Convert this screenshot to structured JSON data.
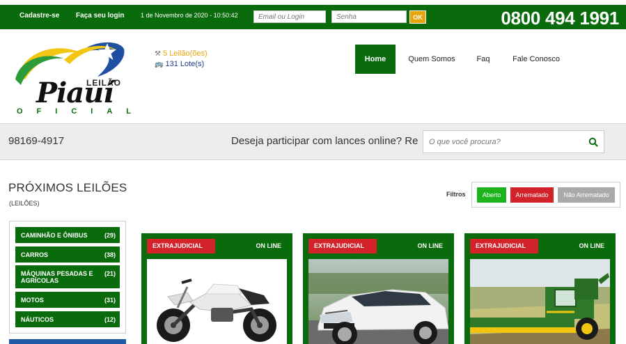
{
  "topbar": {
    "register": "Cadastre-se",
    "login": "Faça seu login",
    "datetime": "1 de Novembro de 2020 - 10:50:42",
    "email_placeholder": "Email ou Login",
    "password_placeholder": "Senha",
    "ok_label": "OK",
    "phone": "0800 494 1991"
  },
  "logo": {
    "word1": "LEILÃO",
    "word2": "Piauí",
    "word3": "OFICIAL"
  },
  "stats": {
    "auctions": "5 Leilão(ões)",
    "lots": "131 Lote(s)"
  },
  "nav": {
    "items": [
      "Home",
      "Quem Somos",
      "Faq",
      "Fale Conosco"
    ]
  },
  "graybar": {
    "phone": "98169-4917",
    "marquee": "Deseja participar com lances online? Re",
    "search_placeholder": "O que você procura?"
  },
  "section": {
    "title": "PRÓXIMOS LEILÕES",
    "subtitle": "(LEILÕES)"
  },
  "filters": {
    "label": "Filtros",
    "open": "Aberto",
    "sold": "Arrematado",
    "not_sold": "Não Arrematado"
  },
  "categories": [
    {
      "name": "CAMINHÃO E ÔNIBUS",
      "count": "(29)"
    },
    {
      "name": "CARROS",
      "count": "(38)"
    },
    {
      "name": "MÁQUINAS PESADAS E AGRÍCOLAS",
      "count": "(21)"
    },
    {
      "name": "MOTOS",
      "count": "(31)"
    },
    {
      "name": "NÁUTICOS",
      "count": "(12)"
    }
  ],
  "cards": [
    {
      "badge": "EXTRAJUDICIAL",
      "status": "ON LINE",
      "image": "motorcycle"
    },
    {
      "badge": "EXTRAJUDICIAL",
      "status": "ON LINE",
      "image": "car"
    },
    {
      "badge": "EXTRAJUDICIAL",
      "status": "ON LINE",
      "image": "harvester"
    }
  ],
  "colors": {
    "brand_green": "#0a6b0c",
    "accent_gold": "#e6a50a",
    "badge_red": "#d3222a",
    "filter_green": "#1cb31c",
    "filter_gray": "#a9a9a9"
  }
}
